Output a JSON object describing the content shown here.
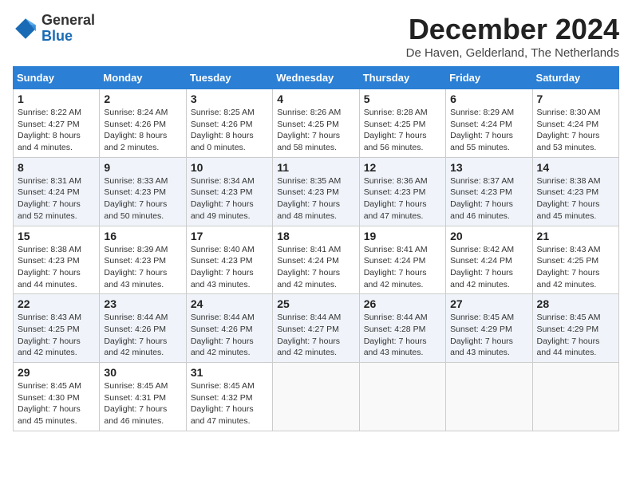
{
  "logo": {
    "line1": "General",
    "line2": "Blue"
  },
  "title": "December 2024",
  "subtitle": "De Haven, Gelderland, The Netherlands",
  "weekdays": [
    "Sunday",
    "Monday",
    "Tuesday",
    "Wednesday",
    "Thursday",
    "Friday",
    "Saturday"
  ],
  "weeks": [
    [
      {
        "day": "1",
        "info": "Sunrise: 8:22 AM\nSunset: 4:27 PM\nDaylight: 8 hours\nand 4 minutes."
      },
      {
        "day": "2",
        "info": "Sunrise: 8:24 AM\nSunset: 4:26 PM\nDaylight: 8 hours\nand 2 minutes."
      },
      {
        "day": "3",
        "info": "Sunrise: 8:25 AM\nSunset: 4:26 PM\nDaylight: 8 hours\nand 0 minutes."
      },
      {
        "day": "4",
        "info": "Sunrise: 8:26 AM\nSunset: 4:25 PM\nDaylight: 7 hours\nand 58 minutes."
      },
      {
        "day": "5",
        "info": "Sunrise: 8:28 AM\nSunset: 4:25 PM\nDaylight: 7 hours\nand 56 minutes."
      },
      {
        "day": "6",
        "info": "Sunrise: 8:29 AM\nSunset: 4:24 PM\nDaylight: 7 hours\nand 55 minutes."
      },
      {
        "day": "7",
        "info": "Sunrise: 8:30 AM\nSunset: 4:24 PM\nDaylight: 7 hours\nand 53 minutes."
      }
    ],
    [
      {
        "day": "8",
        "info": "Sunrise: 8:31 AM\nSunset: 4:24 PM\nDaylight: 7 hours\nand 52 minutes."
      },
      {
        "day": "9",
        "info": "Sunrise: 8:33 AM\nSunset: 4:23 PM\nDaylight: 7 hours\nand 50 minutes."
      },
      {
        "day": "10",
        "info": "Sunrise: 8:34 AM\nSunset: 4:23 PM\nDaylight: 7 hours\nand 49 minutes."
      },
      {
        "day": "11",
        "info": "Sunrise: 8:35 AM\nSunset: 4:23 PM\nDaylight: 7 hours\nand 48 minutes."
      },
      {
        "day": "12",
        "info": "Sunrise: 8:36 AM\nSunset: 4:23 PM\nDaylight: 7 hours\nand 47 minutes."
      },
      {
        "day": "13",
        "info": "Sunrise: 8:37 AM\nSunset: 4:23 PM\nDaylight: 7 hours\nand 46 minutes."
      },
      {
        "day": "14",
        "info": "Sunrise: 8:38 AM\nSunset: 4:23 PM\nDaylight: 7 hours\nand 45 minutes."
      }
    ],
    [
      {
        "day": "15",
        "info": "Sunrise: 8:38 AM\nSunset: 4:23 PM\nDaylight: 7 hours\nand 44 minutes."
      },
      {
        "day": "16",
        "info": "Sunrise: 8:39 AM\nSunset: 4:23 PM\nDaylight: 7 hours\nand 43 minutes."
      },
      {
        "day": "17",
        "info": "Sunrise: 8:40 AM\nSunset: 4:23 PM\nDaylight: 7 hours\nand 43 minutes."
      },
      {
        "day": "18",
        "info": "Sunrise: 8:41 AM\nSunset: 4:24 PM\nDaylight: 7 hours\nand 42 minutes."
      },
      {
        "day": "19",
        "info": "Sunrise: 8:41 AM\nSunset: 4:24 PM\nDaylight: 7 hours\nand 42 minutes."
      },
      {
        "day": "20",
        "info": "Sunrise: 8:42 AM\nSunset: 4:24 PM\nDaylight: 7 hours\nand 42 minutes."
      },
      {
        "day": "21",
        "info": "Sunrise: 8:43 AM\nSunset: 4:25 PM\nDaylight: 7 hours\nand 42 minutes."
      }
    ],
    [
      {
        "day": "22",
        "info": "Sunrise: 8:43 AM\nSunset: 4:25 PM\nDaylight: 7 hours\nand 42 minutes."
      },
      {
        "day": "23",
        "info": "Sunrise: 8:44 AM\nSunset: 4:26 PM\nDaylight: 7 hours\nand 42 minutes."
      },
      {
        "day": "24",
        "info": "Sunrise: 8:44 AM\nSunset: 4:26 PM\nDaylight: 7 hours\nand 42 minutes."
      },
      {
        "day": "25",
        "info": "Sunrise: 8:44 AM\nSunset: 4:27 PM\nDaylight: 7 hours\nand 42 minutes."
      },
      {
        "day": "26",
        "info": "Sunrise: 8:44 AM\nSunset: 4:28 PM\nDaylight: 7 hours\nand 43 minutes."
      },
      {
        "day": "27",
        "info": "Sunrise: 8:45 AM\nSunset: 4:29 PM\nDaylight: 7 hours\nand 43 minutes."
      },
      {
        "day": "28",
        "info": "Sunrise: 8:45 AM\nSunset: 4:29 PM\nDaylight: 7 hours\nand 44 minutes."
      }
    ],
    [
      {
        "day": "29",
        "info": "Sunrise: 8:45 AM\nSunset: 4:30 PM\nDaylight: 7 hours\nand 45 minutes."
      },
      {
        "day": "30",
        "info": "Sunrise: 8:45 AM\nSunset: 4:31 PM\nDaylight: 7 hours\nand 46 minutes."
      },
      {
        "day": "31",
        "info": "Sunrise: 8:45 AM\nSunset: 4:32 PM\nDaylight: 7 hours\nand 47 minutes."
      },
      {
        "day": "",
        "info": ""
      },
      {
        "day": "",
        "info": ""
      },
      {
        "day": "",
        "info": ""
      },
      {
        "day": "",
        "info": ""
      }
    ]
  ]
}
